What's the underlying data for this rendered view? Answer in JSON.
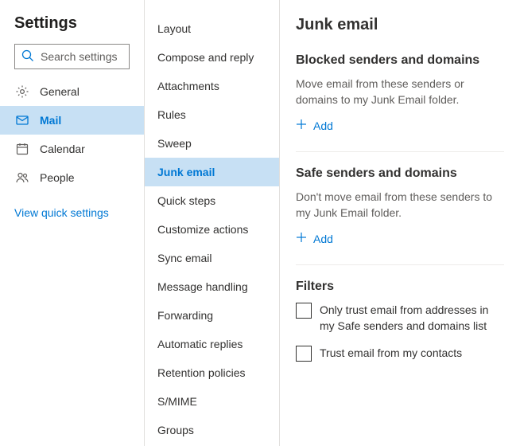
{
  "header": {
    "title": "Settings"
  },
  "search": {
    "placeholder": "Search settings"
  },
  "nav": {
    "items": [
      {
        "label": "General"
      },
      {
        "label": "Mail"
      },
      {
        "label": "Calendar"
      },
      {
        "label": "People"
      }
    ],
    "quick_link": "View quick settings"
  },
  "subnav": {
    "items": [
      {
        "label": "Layout"
      },
      {
        "label": "Compose and reply"
      },
      {
        "label": "Attachments"
      },
      {
        "label": "Rules"
      },
      {
        "label": "Sweep"
      },
      {
        "label": "Junk email"
      },
      {
        "label": "Quick steps"
      },
      {
        "label": "Customize actions"
      },
      {
        "label": "Sync email"
      },
      {
        "label": "Message handling"
      },
      {
        "label": "Forwarding"
      },
      {
        "label": "Automatic replies"
      },
      {
        "label": "Retention policies"
      },
      {
        "label": "S/MIME"
      },
      {
        "label": "Groups"
      }
    ]
  },
  "main": {
    "title": "Junk email",
    "blocked": {
      "title": "Blocked senders and domains",
      "desc": "Move email from these senders or domains to my Junk Email folder.",
      "add": "Add"
    },
    "safe": {
      "title": "Safe senders and domains",
      "desc": "Don't move email from these senders to my Junk Email folder.",
      "add": "Add"
    },
    "filters": {
      "title": "Filters",
      "opt1": "Only trust email from addresses in my Safe senders and domains list",
      "opt2": "Trust email from my contacts"
    }
  }
}
